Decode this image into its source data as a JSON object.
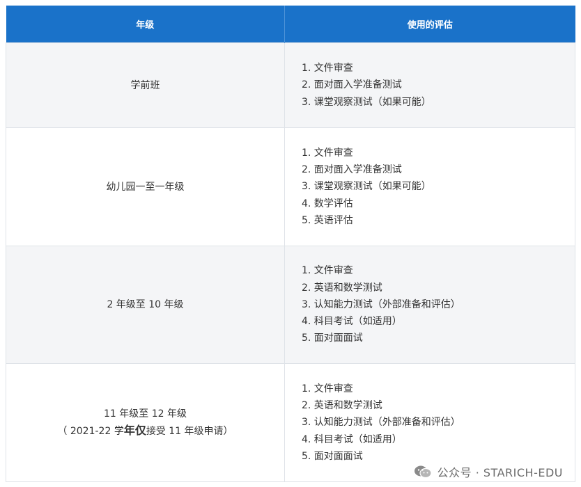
{
  "header": {
    "grade": "年级",
    "assessment": "使用的评估"
  },
  "rows": [
    {
      "grade": "学前班",
      "items": [
        "1. 文件审查",
        "2. 面对面入学准备测试",
        "3. 课堂观察测试（如果可能）"
      ]
    },
    {
      "grade": "幼儿园一至一年级",
      "items": [
        "1. 文件审查",
        "2. 面对面入学准备测试",
        "3. 课堂观察测试（如果可能）",
        "4. 数学评估",
        "5. 英语评估"
      ]
    },
    {
      "grade": "2 年级至 10 年级",
      "items": [
        "1. 文件审查",
        "2. 英语和数学测试",
        "3. 认知能力测试（外部准备和评估）",
        "4. 科目考试（如适用）",
        "5. 面对面面试"
      ]
    },
    {
      "grade": "11 年级至 12 年级",
      "note_pre": "（ 2021-22 学",
      "note_strong": "年仅",
      "note_post": "接受 11 年级申请）",
      "items": [
        "1. 文件审查",
        "2. 英语和数学测试",
        "3. 认知能力测试（外部准备和评估）",
        "4. 科目考试（如适用）",
        "5. 面对面面试"
      ]
    }
  ],
  "watermark": {
    "text": "公众号 · STARICH-EDU",
    "icon": "wechat-icon"
  },
  "colors": {
    "header_bg": "#1a72c9",
    "alt_row_bg": "#f4f5f7",
    "border": "#dfe3e8"
  }
}
